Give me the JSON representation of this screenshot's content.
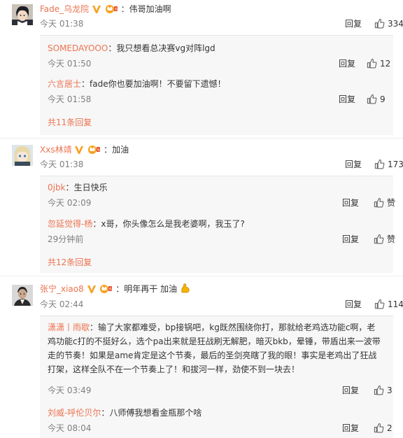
{
  "comments": [
    {
      "user": "Fade_乌龙院",
      "sep": "：",
      "text": "伟哥加油啊",
      "time": "今天 01:38",
      "reply_label": "回复",
      "likes": "334",
      "replies": [
        {
          "user": "SOMEDAYOOO",
          "sep": "：",
          "text": "我只想看总决赛vg对阵lgd",
          "time": "今天 01:50",
          "reply_label": "回复",
          "likes": "12"
        },
        {
          "user": "六言居士",
          "sep": "：",
          "text": "fade你也要加油啊！不要留下遗憾！",
          "time": "今天 01:58",
          "reply_label": "回复",
          "likes": "9"
        }
      ],
      "more": "共11条回复"
    },
    {
      "user": "Xxs林靖",
      "sep": "：",
      "text": "加油",
      "time": "今天 01:38",
      "reply_label": "回复",
      "likes": "173",
      "replies": [
        {
          "user": "0jbk",
          "sep": "：",
          "text": "生日快乐",
          "time": "今天 02:09",
          "reply_label": "回复",
          "likes": "赞"
        },
        {
          "user": "忽延觉得-杨",
          "sep": "：",
          "text": "x哥，你头像怎么是我老婆啊，我玉了?",
          "time": "29分钟前",
          "reply_label": "回复",
          "likes": "赞"
        }
      ],
      "more": "共12条回复"
    },
    {
      "user": "张宁_xiao8",
      "sep": "：",
      "text": "明年再干 加油",
      "time": "今天 02:44",
      "reply_label": "回复",
      "likes": "114",
      "replies": [
        {
          "user": "潇潇丨雨歇",
          "sep": "：",
          "text": "输了大家都难受，bp接锅吧，kg既然围绕你打，那就给老鸡选功能c啊，老鸡功能c打的不挺好么，选个pa出来就是狂战刷无解肥，暗灭bkb，晕锤，带盾出来一波带走的节奏！如果是ame肯定是这个节奏，最后的圣剑亮瞎了我的眼！事实是老鸡出了狂战打架，这样全队不在一个节奏上了！和拔河一样，劲使不到一块去！",
          "time": "今天 03:49",
          "reply_label": "回复",
          "likes": "3"
        },
        {
          "user": "刘威-呼伦贝尔",
          "sep": "：",
          "text": "八师傅我想看金瓶那个啥",
          "time": "今天 08:04",
          "reply_label": "回复",
          "likes": "2"
        }
      ]
    }
  ],
  "colors": {
    "username": "#eb7350",
    "time": "#808080",
    "reply_bg": "#f7f7f7",
    "badge": "#f8a020"
  },
  "icons": {
    "verified": "verified-v-icon",
    "vip": "vip-crown-icon",
    "like": "thumb-up-icon",
    "emoji": "flexed-biceps-emoji"
  }
}
